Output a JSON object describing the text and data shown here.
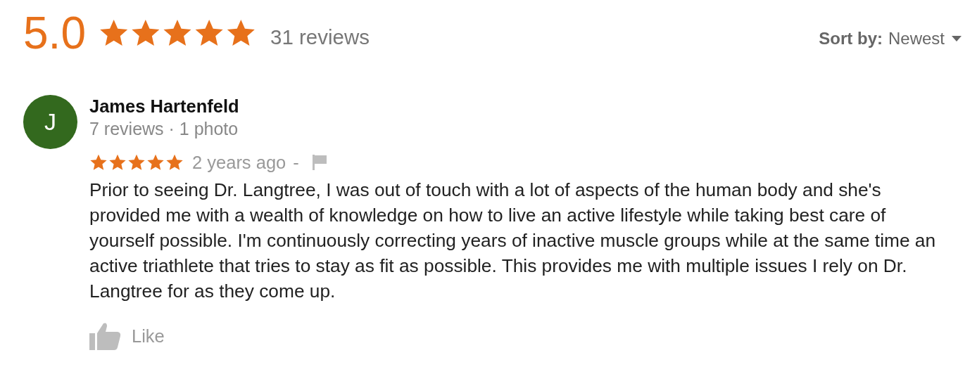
{
  "summary": {
    "rating": "5.0",
    "stars": 5,
    "review_count": "31 reviews"
  },
  "sort": {
    "label": "Sort by:",
    "value": "Newest"
  },
  "reviews": [
    {
      "avatar_letter": "J",
      "color": "#33691e",
      "author": "James Hartenfeld",
      "meta": "7 reviews · 1 photo",
      "stars": 5,
      "time": "2 years ago",
      "separator": "-",
      "text": "Prior to seeing Dr. Langtree, I was out of touch with a lot of aspects of the human body and she's provided me with a wealth of knowledge on how to live an active lifestyle while taking best care of yourself possible. I'm continuously correcting years of inactive muscle groups while at the same time an active triathlete that tries to stay as fit as possible. This provides me with multiple issues I rely on Dr. Langtree for as they come up.",
      "like": "Like"
    }
  ]
}
